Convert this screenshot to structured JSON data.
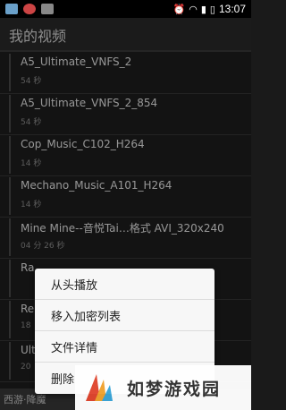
{
  "status_bar": {
    "time": "13:07"
  },
  "header": {
    "title": "我的视频"
  },
  "videos": [
    {
      "name": "A5_Ultimate_VNFS_2",
      "duration": "54 秒"
    },
    {
      "name": "A5_Ultimate_VNFS_2_854",
      "duration": "54 秒"
    },
    {
      "name": "Cop_Music_C102_H264",
      "duration": "14 秒"
    },
    {
      "name": "Mechano_Music_A101_H264",
      "duration": "14 秒"
    },
    {
      "name": "Mine Mine--音悦Tai…格式 AVI_320x240",
      "duration": "04 分 26 秒"
    },
    {
      "name": "Ra",
      "duration": ""
    },
    {
      "name": "Re",
      "duration": "18"
    },
    {
      "name": "Ult",
      "duration": "20"
    }
  ],
  "context_menu": {
    "items": [
      "从头播放",
      "移入加密列表",
      "文件详情",
      "删除"
    ]
  },
  "bottom_bar": {
    "text": "西游·降魔"
  },
  "watermark": {
    "brand": "如梦游戏园"
  }
}
